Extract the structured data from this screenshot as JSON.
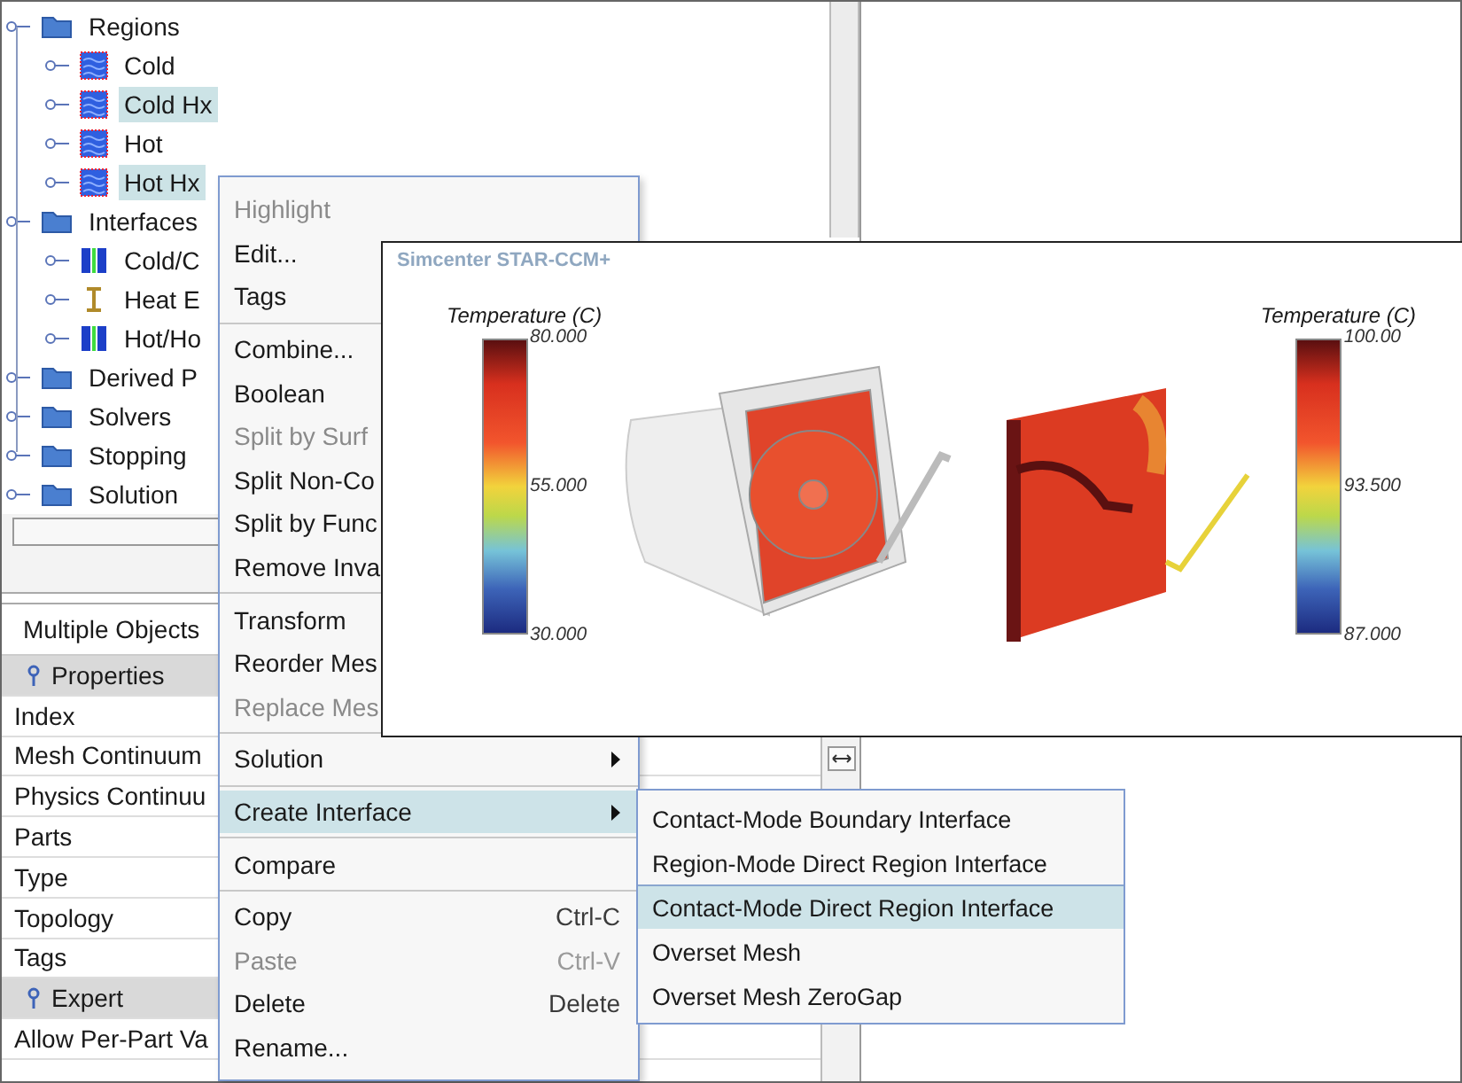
{
  "tree": {
    "items": [
      {
        "kind": "folder",
        "label": "Regions",
        "selected": false,
        "children": [
          {
            "kind": "region",
            "label": "Cold",
            "selected": false
          },
          {
            "kind": "region",
            "label": "Cold Hx",
            "selected": true
          },
          {
            "kind": "region",
            "label": "Hot",
            "selected": false
          },
          {
            "kind": "region",
            "label": "Hot Hx",
            "selected": true
          }
        ]
      },
      {
        "kind": "folder",
        "label": "Interfaces",
        "selected": false,
        "children": [
          {
            "kind": "interface",
            "label": "Cold/C",
            "selected": false
          },
          {
            "kind": "contact",
            "label": "Heat E",
            "selected": false
          },
          {
            "kind": "interface",
            "label": "Hot/Ho",
            "selected": false
          }
        ]
      },
      {
        "kind": "folder",
        "label": "Derived P",
        "selected": false
      },
      {
        "kind": "folder",
        "label": "Solvers",
        "selected": false
      },
      {
        "kind": "folder",
        "label": "Stopping",
        "selected": false
      },
      {
        "kind": "folder",
        "label": "Solution",
        "selected": false
      }
    ]
  },
  "properties": {
    "title": "Multiple Objects",
    "rows": [
      {
        "kind": "section",
        "label": "Properties"
      },
      {
        "kind": "row",
        "label": "Index"
      },
      {
        "kind": "row",
        "label": "Mesh Continuum"
      },
      {
        "kind": "row",
        "label": "Physics Continuu"
      },
      {
        "kind": "row",
        "label": "Parts"
      },
      {
        "kind": "row",
        "label": "Type"
      },
      {
        "kind": "row",
        "label": "Topology"
      },
      {
        "kind": "row",
        "label": "Tags"
      },
      {
        "kind": "section",
        "label": "Expert"
      },
      {
        "kind": "row",
        "label": "Allow Per-Part Va"
      }
    ]
  },
  "context_menu": {
    "groups": [
      [
        {
          "label": "Highlight",
          "disabled": true,
          "selected": false
        },
        {
          "label": "Edit...",
          "disabled": false,
          "selected": false
        },
        {
          "label": "Tags",
          "disabled": false,
          "selected": false
        }
      ],
      [
        {
          "label": "Combine...",
          "disabled": false,
          "selected": false
        },
        {
          "label": "Boolean",
          "disabled": false,
          "selected": false
        },
        {
          "label": "Split by Surf",
          "disabled": true,
          "selected": false
        },
        {
          "label": "Split Non-Co",
          "disabled": false,
          "selected": false
        },
        {
          "label": "Split by Func",
          "disabled": false,
          "selected": false
        },
        {
          "label": "Remove Inva",
          "disabled": false,
          "selected": false
        }
      ],
      [
        {
          "label": "Transform",
          "disabled": false,
          "selected": false
        },
        {
          "label": "Reorder Mes",
          "disabled": false,
          "selected": false
        },
        {
          "label": "Replace Mes",
          "disabled": true,
          "selected": false
        }
      ],
      [
        {
          "label": "Solution",
          "disabled": false,
          "selected": false,
          "submenu": true
        }
      ],
      [
        {
          "label": "Create Interface",
          "disabled": false,
          "selected": true,
          "submenu": true
        }
      ],
      [
        {
          "label": "Compare",
          "disabled": false,
          "selected": false
        }
      ],
      [
        {
          "label": "Copy",
          "shortcut": "Ctrl-C",
          "disabled": false,
          "selected": false
        },
        {
          "label": "Paste",
          "shortcut": "Ctrl-V",
          "disabled": true,
          "selected": false
        },
        {
          "label": "Delete",
          "shortcut": "Delete",
          "disabled": false,
          "selected": false
        },
        {
          "label": "Rename...",
          "disabled": false,
          "selected": false
        }
      ]
    ]
  },
  "submenu": {
    "items": [
      {
        "label": "Contact-Mode Boundary Interface",
        "selected": false
      },
      {
        "label": "Region-Mode Direct Region Interface",
        "selected": false
      },
      {
        "label": "Contact-Mode Direct Region Interface",
        "selected": true
      },
      {
        "label": "Overset Mesh",
        "selected": false
      },
      {
        "label": "Overset Mesh ZeroGap",
        "selected": false
      }
    ]
  },
  "graphics_window": {
    "title": "Simcenter STAR-CCM+",
    "legends": [
      {
        "title": "Temperature (C)",
        "ticks": [
          "80.000",
          "55.000",
          "30.000"
        ]
      },
      {
        "title": "Temperature (C)",
        "ticks": [
          "100.00",
          "93.500",
          "87.000"
        ]
      }
    ]
  }
}
